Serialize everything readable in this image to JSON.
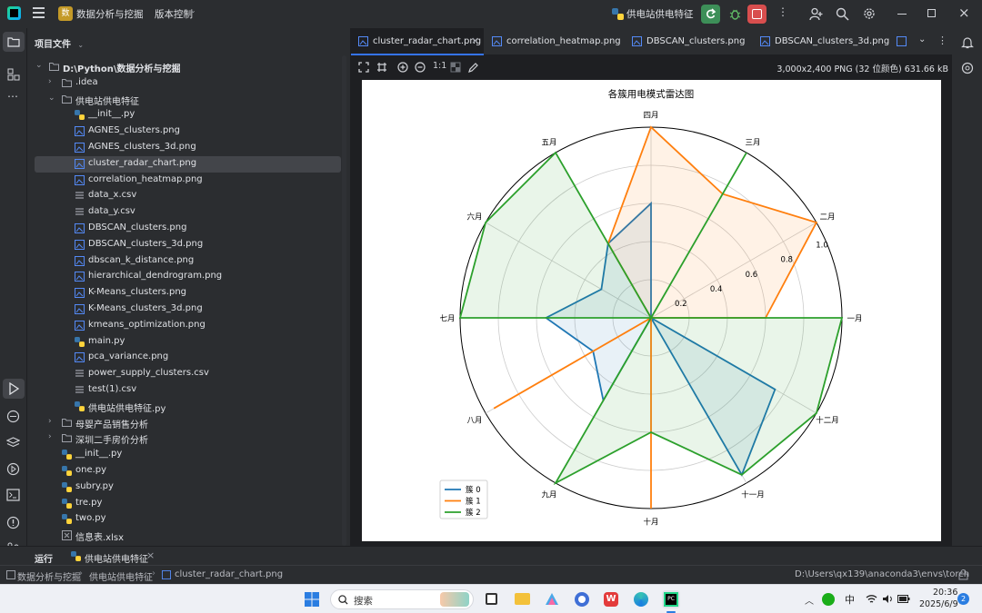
{
  "titlebar": {
    "project_badge": "数",
    "project_name": "数据分析与挖掘",
    "vcs": "版本控制",
    "run_config": "供电站供电特征"
  },
  "project_panel": {
    "title": "项目文件",
    "items": [
      {
        "label": "D:\\Python\\数据分析与挖掘",
        "type": "root-folder"
      },
      {
        "label": ".idea",
        "type": "folder"
      },
      {
        "label": "供电站供电特征",
        "type": "folder-open"
      },
      {
        "label": "__init__.py",
        "type": "py"
      },
      {
        "label": "AGNES_clusters.png",
        "type": "png"
      },
      {
        "label": "AGNES_clusters_3d.png",
        "type": "png"
      },
      {
        "label": "cluster_radar_chart.png",
        "type": "png"
      },
      {
        "label": "correlation_heatmap.png",
        "type": "png"
      },
      {
        "label": "data_x.csv",
        "type": "csv"
      },
      {
        "label": "data_y.csv",
        "type": "csv"
      },
      {
        "label": "DBSCAN_clusters.png",
        "type": "png"
      },
      {
        "label": "DBSCAN_clusters_3d.png",
        "type": "png"
      },
      {
        "label": "dbscan_k_distance.png",
        "type": "png"
      },
      {
        "label": "hierarchical_dendrogram.png",
        "type": "png"
      },
      {
        "label": "K-Means_clusters.png",
        "type": "png"
      },
      {
        "label": "K-Means_clusters_3d.png",
        "type": "png"
      },
      {
        "label": "kmeans_optimization.png",
        "type": "png"
      },
      {
        "label": "main.py",
        "type": "py"
      },
      {
        "label": "pca_variance.png",
        "type": "png"
      },
      {
        "label": "power_supply_clusters.csv",
        "type": "csv"
      },
      {
        "label": "test(1).csv",
        "type": "csv"
      },
      {
        "label": "供电站供电特征.py",
        "type": "py"
      },
      {
        "label": "母婴产品销售分析",
        "type": "folder"
      },
      {
        "label": "深圳二手房价分析",
        "type": "folder"
      },
      {
        "label": "__init__.py",
        "type": "py"
      },
      {
        "label": "one.py",
        "type": "py"
      },
      {
        "label": "subry.py",
        "type": "py"
      },
      {
        "label": "tre.py",
        "type": "py"
      },
      {
        "label": "two.py",
        "type": "py"
      },
      {
        "label": "信息表.xlsx",
        "type": "xlsx"
      }
    ]
  },
  "editor_tabs": [
    {
      "label": "cluster_radar_chart.png"
    },
    {
      "label": "correlation_heatmap.png"
    },
    {
      "label": "DBSCAN_clusters.png"
    },
    {
      "label": "DBSCAN_clusters_3d.png"
    }
  ],
  "image_toolbar": {
    "zoom_label": "1:1",
    "image_info": "3,000x2,400 PNG (32 位颜色) 631.66 kB"
  },
  "chart_data": {
    "type": "radar",
    "title": "各簇用电模式雷达图",
    "categories": [
      "一月",
      "二月",
      "三月",
      "四月",
      "五月",
      "六月",
      "七月",
      "八月",
      "九月",
      "十月",
      "十一月",
      "十二月"
    ],
    "radial_ticks": [
      "0.2",
      "0.4",
      "0.6",
      "0.8",
      "1.0"
    ],
    "rlim": [
      0,
      1.0
    ],
    "series": [
      {
        "name": "簇 0",
        "color": "#1f77b4",
        "values": [
          0.0,
          0.0,
          0.0,
          0.6,
          0.45,
          0.3,
          0.55,
          0.35,
          0.5,
          0.0,
          0.95,
          0.75
        ]
      },
      {
        "name": "簇 1",
        "color": "#ff7f0e",
        "values": [
          0.6,
          1.0,
          0.75,
          1.0,
          0.45,
          0.0,
          0.0,
          0.95,
          0.0,
          1.0,
          0.0,
          0.0
        ]
      },
      {
        "name": "簇 2",
        "color": "#2ca02c",
        "values": [
          1.0,
          0.0,
          1.0,
          0.0,
          1.0,
          1.0,
          1.0,
          0.0,
          1.0,
          0.6,
          0.95,
          1.0
        ]
      }
    ],
    "legend_position": "lower-left",
    "grid": true
  },
  "bottom_panel": {
    "run_label": "运行",
    "run_tab": "供电站供电特征"
  },
  "statusbar": {
    "crumbs": [
      "数据分析与挖掘",
      "供电站供电特征",
      "cluster_radar_chart.png"
    ],
    "interpreter_path": "D:\\Users\\qx139\\anaconda3\\envs\\torch"
  },
  "taskbar": {
    "search_placeholder": "搜索",
    "ime": "中",
    "time": "20:36",
    "date": "2025/6/9",
    "notif_count": "2"
  }
}
